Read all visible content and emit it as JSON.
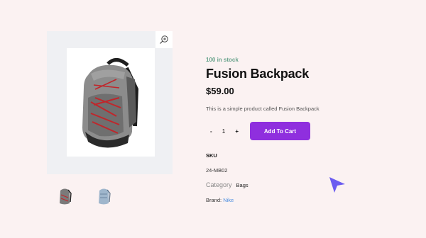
{
  "product": {
    "stock": "100 in stock",
    "title": "Fusion Backpack",
    "price": "$59.00",
    "description": "This is a simple product called Fusion Backpack"
  },
  "quantity": {
    "minus": "-",
    "value": "1",
    "plus": "+"
  },
  "actions": {
    "add_to_cart": "Add To Cart"
  },
  "meta": {
    "sku_label": "SKU",
    "sku_value": "24-MB02",
    "category_label": "Category",
    "category_value": "Bags",
    "brand_label": "Brand: ",
    "brand_value": "Nike"
  },
  "icons": {
    "zoom": "zoom-in-icon",
    "cursor": "pointer-arrow-icon"
  },
  "colors": {
    "accent": "#8f2fde",
    "stock": "#6aa48d",
    "link": "#4a8de0",
    "cursor": "#6b5cf0"
  }
}
